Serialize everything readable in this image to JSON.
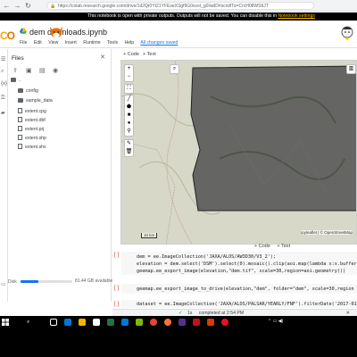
{
  "browser": {
    "url": "https://colab.research.google.com/drive/1d2Qr0Yt21YFEseXSgf9G0xsot_g0IwdD#scrollTo=CrcH08WStIJT"
  },
  "notice": {
    "text": "This notebook is open with private outputs. Outputs will not be saved. You can disable this in ",
    "link": "Notebook settings"
  },
  "header": {
    "logo_text": "CO",
    "title": "dem downloads.ipynb",
    "menu": [
      "File",
      "Edit",
      "View",
      "Insert",
      "Runtime",
      "Tools",
      "Help"
    ],
    "saved_status": "All changes saved"
  },
  "files_panel": {
    "title": "Files",
    "tree": [
      {
        "name": "..",
        "type": "folder",
        "indent": 0
      },
      {
        "name": "config",
        "type": "folder",
        "indent": 1
      },
      {
        "name": "sample_data",
        "type": "folder",
        "indent": 1
      },
      {
        "name": "extent.cpg",
        "type": "file",
        "indent": 1
      },
      {
        "name": "extent.dbf",
        "type": "file",
        "indent": 1
      },
      {
        "name": "extent.prj",
        "type": "file",
        "indent": 1
      },
      {
        "name": "extent.shp",
        "type": "file",
        "indent": 1
      },
      {
        "name": "extent.shx",
        "type": "file",
        "indent": 1
      }
    ],
    "disk_label": "Disk",
    "disk_usage_text": "81.44 GB available",
    "disk_fraction": 0.35
  },
  "notebook": {
    "add_code_label": "+ Code",
    "add_text_label": "+ Text",
    "map_attribution": "ipyleaflet | © OpenStreetMap",
    "map_scale_text": "10 km",
    "cells": [
      {
        "bracket": "[ ]",
        "lines": [
          "dem = ee.ImageCollection('JAXA/ALOS/AW3D30/V3_2');",
          "elevation = dem.select('DSM').select(0).mosaic().clip(aoi.map(lambda x:x.buffer",
          "geemap.ee_export_image(elevation,\"dem.tif\", scale=30,region=aoi.geometry())"
        ]
      },
      {
        "bracket": "[ ]",
        "lines": [
          "geemap.ee_export_image_to_drive(elevation,\"dem\", folder=\"dem\", scale=30,region"
        ]
      },
      {
        "bracket": "[ ]",
        "lines": [
          "dataset = ee.ImageCollection('JAXA/ALOS/PALSAR/YEARLY/FNF').filterDate('2017-01"
        ]
      }
    ]
  },
  "statusbar": {
    "check": "✓",
    "duration": "1s",
    "completed": "completed at 2:54 PM"
  },
  "colors": {
    "accent": "#1a73e8",
    "logo_yellow": "#f9ab00",
    "logo_orange": "#e37400",
    "aoi_fill": "#555555",
    "map_bg": "#d7d8c7"
  }
}
